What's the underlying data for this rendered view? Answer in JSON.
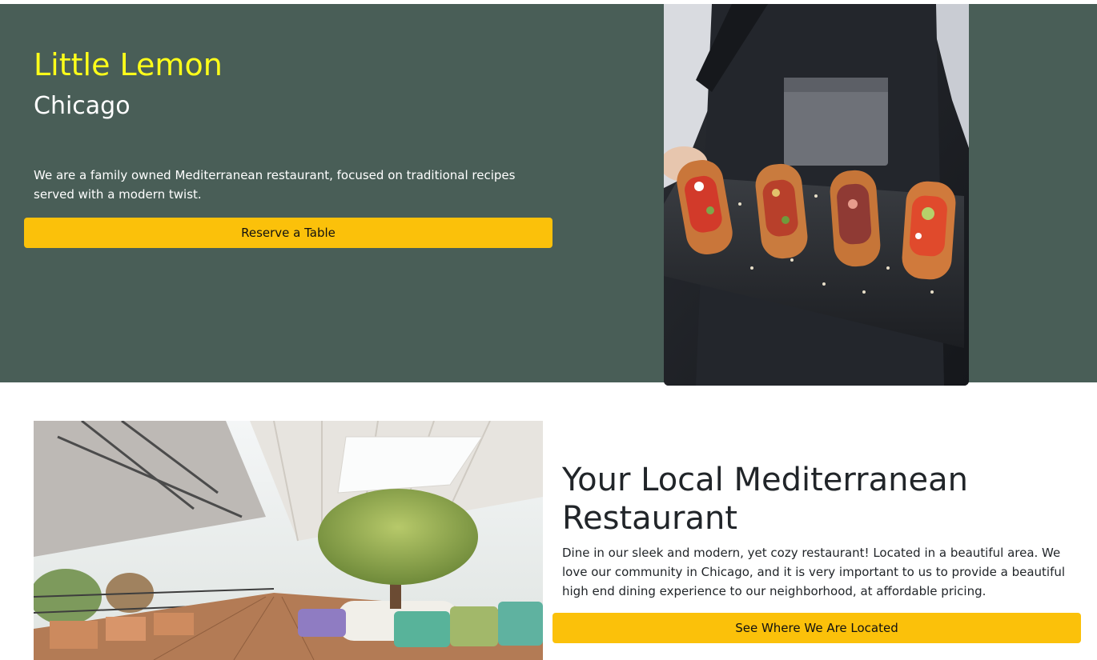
{
  "hero": {
    "title": "Little Lemon",
    "subtitle": "Chicago",
    "description": "We are a family owned Mediterranean restaurant, focused on traditional recipes served with a modern twist.",
    "reserve_label": "Reserve a Table",
    "bg_color": "#495e57",
    "title_color": "#ffff1a",
    "button_color": "#fbc10a"
  },
  "about": {
    "title": "Your Local Mediterranean Restaurant",
    "text": "Dine in our sleek and modern, yet cozy restaurant! Located in a beautiful area. We love our community in Chicago, and it is very important to us to provide a beautiful high end dining experience to our neighborhood, at affordable pricing.",
    "locate_label": "See Where We Are Located"
  }
}
